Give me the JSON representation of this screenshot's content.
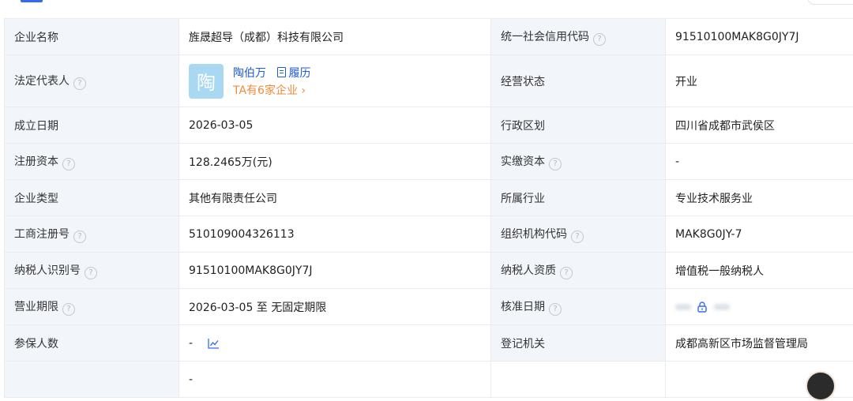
{
  "rows": [
    {
      "l1": "企业名称",
      "v1": "旌晟超导（成都）科技有限公司",
      "l2": "统一社会信用代码",
      "v2": "91510100MAK8G0JY7J"
    },
    {
      "l1": "法定代表人",
      "l2": "经营状态",
      "v2": "开业"
    },
    {
      "l1": "成立日期",
      "v1": "2026-03-05",
      "l2": "行政区划",
      "v2": "四川省成都市武侯区"
    },
    {
      "l1": "注册资本",
      "v1": "128.2465万(元)",
      "l2": "实缴资本",
      "v2": "-"
    },
    {
      "l1": "企业类型",
      "v1": "其他有限责任公司",
      "l2": "所属行业",
      "v2": "专业技术服务业"
    },
    {
      "l1": "工商注册号",
      "v1": "510109004326113",
      "l2": "组织机构代码",
      "v2": "MAK8G0JY-7"
    },
    {
      "l1": "纳税人识别号",
      "v1": "91510100MAK8G0JY7J",
      "l2": "纳税人资质",
      "v2": "增值税一般纳税人"
    },
    {
      "l1": "营业期限",
      "v1": "2026-03-05 至 无固定期限",
      "l2": "核准日期"
    },
    {
      "l1": "参保人数",
      "v1": "-",
      "l2": "登记机关",
      "v2": "成都高新区市场监督管理局"
    },
    {
      "v1": "-"
    }
  ],
  "legal_rep": {
    "avatar_char": "陶",
    "name": "陶伯万",
    "resume": "履历",
    "companies": "TA有6家企业 ›"
  },
  "icons": {
    "help": "question-circle-icon",
    "lock": "lock-icon",
    "chart": "line-chart-icon",
    "resume": "document-icon"
  },
  "colors": {
    "link": "#1f5bd6",
    "accent_orange": "#f08b3a",
    "label_bg": "#f2f5fa",
    "border": "#e9ecf1",
    "tab_active": "#2f6bf6"
  }
}
